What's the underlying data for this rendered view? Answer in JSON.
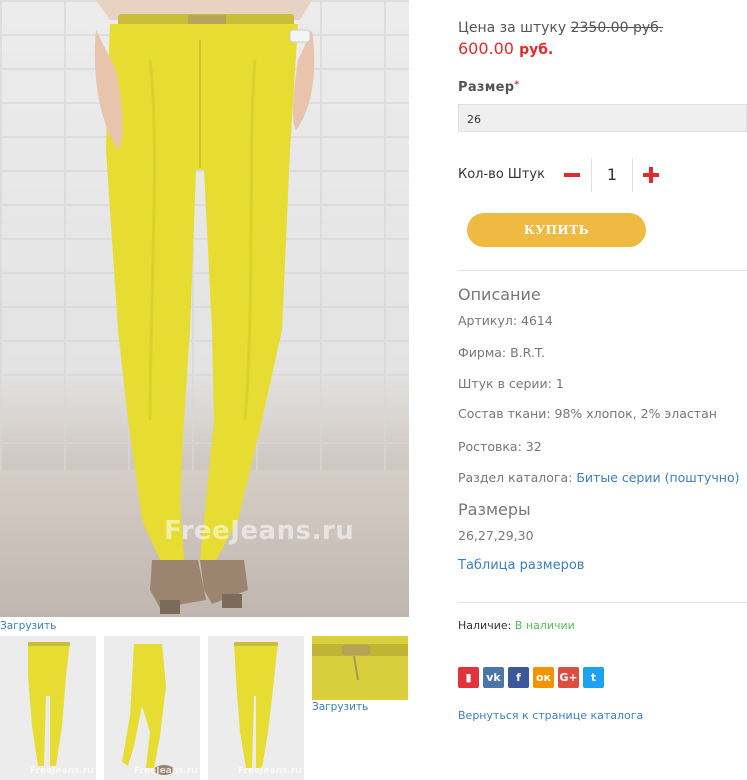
{
  "gallery": {
    "main_watermark": "FreeJeans.ru",
    "main_download_label": "Загрузить",
    "thumb_download_label": "Загрузить",
    "thumb_watermark": "FreeJeans.ru"
  },
  "product": {
    "price_label": "Цена за штуку",
    "old_price": "2350.00 руб.",
    "new_price_value": "600.00",
    "new_price_currency": "руб.",
    "size_label": "Размер",
    "size_required_mark": "*",
    "size_selected": "26",
    "qty_label": "Кол-во Штук",
    "qty_value": "1",
    "buy_label": "КУПИТЬ"
  },
  "description": {
    "title": "Описание",
    "article": "Артикул: 4614",
    "brand": "Фирма: B.R.T.",
    "pieces": "Штук в серии: 1",
    "fabric": "Состав ткани: 98% хлопок, 2% эластан",
    "height": "Ростовка: 32",
    "catalog_label": "Раздел каталога:",
    "catalog_link": "Битые серии (поштучно)"
  },
  "sizes": {
    "title": "Размеры",
    "values": "26,27,29,30",
    "table_link": "Таблица размеров"
  },
  "stock": {
    "label": "Наличие:",
    "value": "В наличии"
  },
  "social": [
    {
      "name": "bookmark",
      "glyph": "▮",
      "color": "#e0343a"
    },
    {
      "name": "vk",
      "glyph": "vk",
      "color": "#4a76a8"
    },
    {
      "name": "facebook",
      "glyph": "f",
      "color": "#3b5998"
    },
    {
      "name": "odnoklassniki",
      "glyph": "ок",
      "color": "#f29400"
    },
    {
      "name": "google-plus",
      "glyph": "G+",
      "color": "#dc4e41"
    },
    {
      "name": "twitter",
      "glyph": "t",
      "color": "#1da1f2"
    }
  ],
  "back_link": "Вернуться к странице каталога",
  "colors": {
    "accent_red": "#e22a2a",
    "buy_button": "#f0b942",
    "link_blue": "#3a7fbf",
    "in_stock_green": "#5cb85c",
    "pants_yellow": "#e6dc32"
  }
}
